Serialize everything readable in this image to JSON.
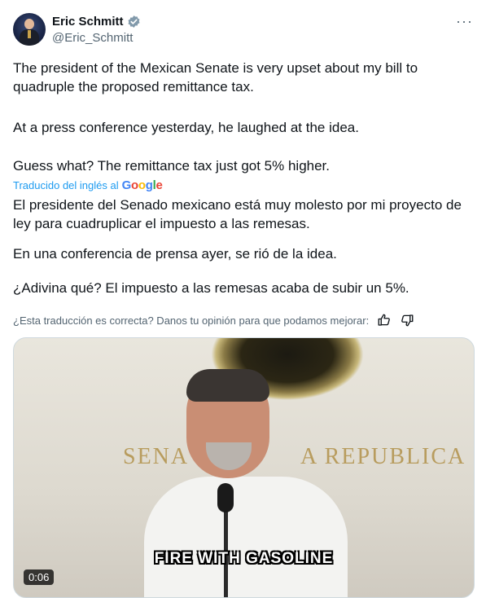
{
  "author": {
    "name": "Eric Schmitt",
    "handle": "@Eric_Schmitt",
    "verified_color": "#829aab"
  },
  "more_label": "···",
  "tweet": {
    "paragraphs": [
      "The president of the Mexican Senate is very upset about my bill to quadruple the proposed remittance tax.",
      "At a press conference yesterday, he laughed at the idea.",
      "Guess what? The remittance tax just got 5% higher."
    ]
  },
  "translation": {
    "attribution": "Traducido del inglés al",
    "provider": "Google",
    "paragraphs": [
      "El presidente del Senado mexicano está muy molesto por mi proyecto de ley para cuadruplicar el impuesto a las remesas.",
      "En una conferencia de prensa ayer, se rió de la idea.",
      "¿Adivina qué? El impuesto a las remesas acaba de subir un 5%."
    ],
    "feedback": "¿Esta traducción es correcta? Danos tu opinión para que podamos mejorar:"
  },
  "video": {
    "wall_text_left": "SENA",
    "wall_text_right": "A REPUBLICA",
    "caption": "FIRE WITH GASOLINE",
    "duration": "0:06"
  },
  "icons": {
    "verified": "verified-badge-icon",
    "more": "more-icon",
    "thumbs_up": "thumbs-up-icon",
    "thumbs_down": "thumbs-down-icon"
  }
}
